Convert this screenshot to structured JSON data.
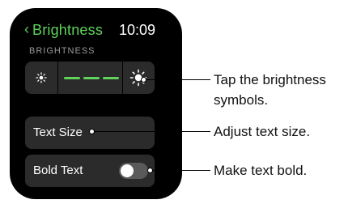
{
  "screen": {
    "back_glyph": "‹",
    "title": "Brightness",
    "time": "10:09",
    "section_label": "BRIGHTNESS"
  },
  "brightness": {
    "decrease_icon": "sun-small-icon",
    "increase_icon": "sun-large-icon",
    "level_segments_filled": 3,
    "level_segments_total": 3
  },
  "rows": {
    "text_size_label": "Text Size",
    "bold_text_label": "Bold Text",
    "bold_text_on": false
  },
  "callouts": {
    "brightness_line1": "Tap the brightness",
    "brightness_line2": "symbols.",
    "text_size": "Adjust text size.",
    "bold_text": "Make text bold."
  },
  "colors": {
    "accent": "#5fd35c",
    "panel": "#2b2b2b",
    "background": "#000000"
  }
}
